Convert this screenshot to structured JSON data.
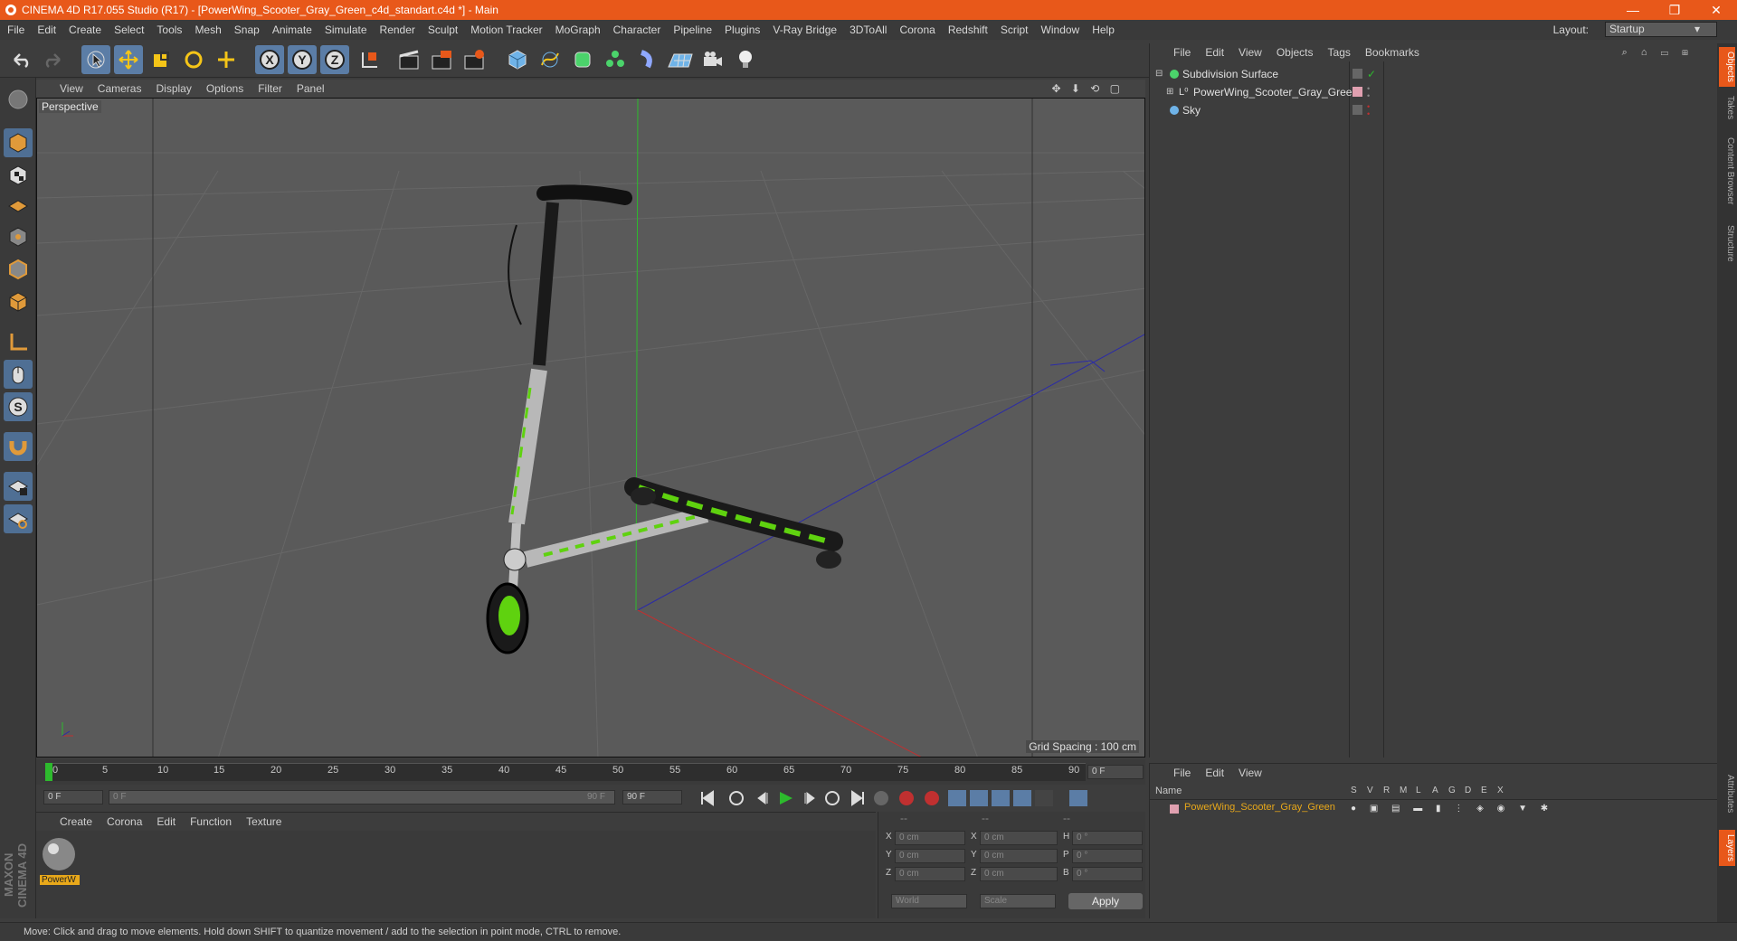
{
  "window": {
    "title": "CINEMA 4D R17.055 Studio (R17) - [PowerWing_Scooter_Gray_Green_c4d_standart.c4d *] - Main",
    "minimize": "—",
    "restore": "❐",
    "close": "✕"
  },
  "menu": {
    "items": [
      "File",
      "Edit",
      "Create",
      "Select",
      "Tools",
      "Mesh",
      "Snap",
      "Animate",
      "Simulate",
      "Render",
      "Sculpt",
      "Motion Tracker",
      "MoGraph",
      "Character",
      "Pipeline",
      "Plugins",
      "V-Ray Bridge",
      "3DToAll",
      "Corona",
      "Redshift",
      "Script",
      "Window",
      "Help"
    ],
    "layout_label": "Layout:",
    "layout_value": "Startup"
  },
  "viewport": {
    "menu": [
      "View",
      "Cameras",
      "Display",
      "Options",
      "Filter",
      "Panel"
    ],
    "camera_label": "Perspective",
    "grid_spacing": "Grid Spacing : 100 cm"
  },
  "timeline": {
    "ticks": [
      "0",
      "5",
      "10",
      "15",
      "20",
      "25",
      "30",
      "35",
      "40",
      "45",
      "50",
      "55",
      "60",
      "65",
      "70",
      "75",
      "80",
      "85",
      "90"
    ],
    "end_frame": "0 F"
  },
  "anim": {
    "start": "0 F",
    "range_start": "0 F",
    "range_end": "90 F",
    "end": "90 F"
  },
  "material_panel": {
    "menu": [
      "Create",
      "Corona",
      "Edit",
      "Function",
      "Texture"
    ],
    "material_name": "PowerW"
  },
  "coordinates": {
    "headers": [
      "--",
      "--",
      "--"
    ],
    "rows": [
      {
        "a": "X",
        "av": "0 cm",
        "b": "X",
        "bv": "0 cm",
        "c": "H",
        "cv": "0 °"
      },
      {
        "a": "Y",
        "av": "0 cm",
        "b": "Y",
        "bv": "0 cm",
        "c": "P",
        "cv": "0 °"
      },
      {
        "a": "Z",
        "av": "0 cm",
        "b": "Z",
        "bv": "0 cm",
        "c": "B",
        "cv": "0 °"
      }
    ],
    "world": "World",
    "scale": "Scale",
    "apply": "Apply"
  },
  "objects_panel": {
    "menu": [
      "File",
      "Edit",
      "View",
      "Objects",
      "Tags",
      "Bookmarks"
    ],
    "objects": [
      "Subdivision Surface",
      "PowerWing_Scooter_Gray_Green",
      "Sky"
    ]
  },
  "layers_panel": {
    "menu": [
      "File",
      "Edit",
      "View"
    ],
    "name_header": "Name",
    "cols": [
      "S",
      "V",
      "R",
      "M",
      "L",
      "A",
      "G",
      "D",
      "E",
      "X"
    ],
    "layer_name": "PowerWing_Scooter_Gray_Green"
  },
  "side_tabs": [
    "Objects",
    "Takes",
    "Content Browser",
    "Structure",
    "Attributes",
    "Layers"
  ],
  "brand": "MAXON CINEMA 4D",
  "status": "Move: Click and drag to move elements. Hold down SHIFT to quantize movement / add to the selection in point mode, CTRL to remove.",
  "colors": {
    "accent": "#e8581a",
    "active_tool": "#5b7da6",
    "scooter_green": "#5fd20f"
  }
}
